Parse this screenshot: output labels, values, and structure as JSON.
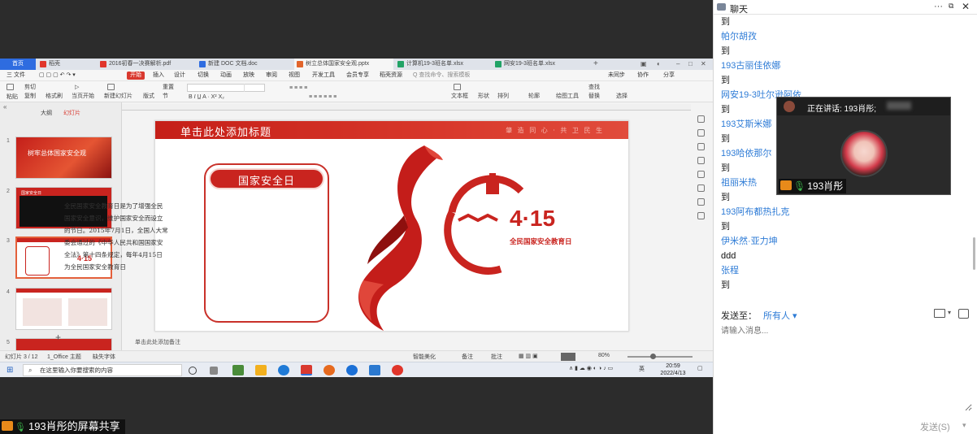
{
  "wps": {
    "tabs": [
      {
        "label": "首页",
        "color": "#2e6ce0"
      },
      {
        "label": "稻壳",
        "color": "#e0352b"
      },
      {
        "label": "2016初春一决赛解析.pdf",
        "color": "#e0352b"
      },
      {
        "label": "新建 DOC 文档.doc",
        "color": "#2e6ce0"
      },
      {
        "label": "树立总体国家安全观.pptx",
        "color": "#e2652b"
      },
      {
        "label": "计算机19-3班名单.xlsx",
        "color": "#21a366"
      },
      {
        "label": "网安19-3班名单.xlsx",
        "color": "#21a366"
      }
    ],
    "menu": {
      "file": "三 文件",
      "items": [
        "开始",
        "插入",
        "设计",
        "切换",
        "动画",
        "放映",
        "审阅",
        "视图",
        "开发工具",
        "会员专享",
        "稻壳资源"
      ],
      "active": "开始",
      "search": "Q 查找命令、搜索模板",
      "right": [
        "未同步",
        "协作",
        "分享"
      ]
    },
    "ribbon": {
      "paste": "粘贴",
      "cut": "剪切",
      "copy": "复制",
      "format_painter": "格式刷",
      "from_current": "当页开始",
      "new_slide": "新建幻灯片",
      "layout": "版式",
      "section": "节",
      "reset": "重置",
      "textbox": "文本框",
      "shape": "形状",
      "arrange": "排列",
      "outline": "轮廓",
      "find": "查找",
      "replace": "替换",
      "select": "选择",
      "drawing_tools": "绘图工具"
    },
    "thumbnails": {
      "tab_outline": "大纲",
      "tab_slides": "幻灯片",
      "numbers": [
        "1",
        "2",
        "3",
        "4",
        "5"
      ],
      "t1_title": "树牢总体国家安全观",
      "t2_title": "国家安全日"
    },
    "slide": {
      "title": "单击此处添加标题",
      "slogan": "肇 造 同 心 · 共 卫 民 生",
      "card_title": "国家安全日",
      "card_body": "全民国家安全教育日是为了增强全民国家安全意识，维护国家安全而设立的节日。2015年7月1日，全国人大常委会通过的《中华人民共和国国家安全法》第十四条规定，每年4月15日为全民国家安全教育日",
      "logo_number": "4·15",
      "logo_caption": "全民国家安全教育日"
    },
    "notes_placeholder": "单击此处添加备注",
    "status": {
      "slide": "幻灯片 3 / 12",
      "theme": "1_Office 主题",
      "font_missing": "缺失字体",
      "smart_beautify": "智能美化",
      "notes": "备注",
      "comments": "批注",
      "zoom": "80%"
    }
  },
  "taskbar": {
    "search_placeholder": "在这里输入你要搜索的内容",
    "time": "20:59",
    "date": "2022/4/13",
    "ime": "英"
  },
  "share_caption": "193肖彤的屏幕共享",
  "chat": {
    "title": "聊天",
    "messages": [
      {
        "kind": "to",
        "text": "到"
      },
      {
        "kind": "sender",
        "text": "帕尔胡孜"
      },
      {
        "kind": "to",
        "text": "到"
      },
      {
        "kind": "sender",
        "text": "193古丽佳依娜"
      },
      {
        "kind": "to",
        "text": "到"
      },
      {
        "kind": "sender",
        "text": "网安19-3吐尔逊阿依"
      },
      {
        "kind": "to",
        "text": "到"
      },
      {
        "kind": "sender",
        "text": "193艾斯米娜"
      },
      {
        "kind": "to",
        "text": "到"
      },
      {
        "kind": "sender",
        "text": "193哈依那尔"
      },
      {
        "kind": "to",
        "text": "到"
      },
      {
        "kind": "sender",
        "text": "祖丽米热"
      },
      {
        "kind": "to",
        "text": "到"
      },
      {
        "kind": "sender",
        "text": "193阿布都热扎克"
      },
      {
        "kind": "to",
        "text": "到"
      },
      {
        "kind": "sender",
        "text": "伊米然·亚力坤"
      },
      {
        "kind": "text",
        "text": "ddd"
      },
      {
        "kind": "sender",
        "text": "张程"
      },
      {
        "kind": "to",
        "text": "到"
      }
    ],
    "send_to_label": "发送至：",
    "send_to_value": "所有人 ▾",
    "input_placeholder": "请输入消息...",
    "send_button": "发送(S)"
  },
  "video": {
    "speaking": "正在讲话: 193肖彤;",
    "name": "193肖彤"
  },
  "colors": {
    "accent_red": "#c9241f",
    "link_blue": "#2d7bd6",
    "wps_blue": "#2e6ce0"
  }
}
